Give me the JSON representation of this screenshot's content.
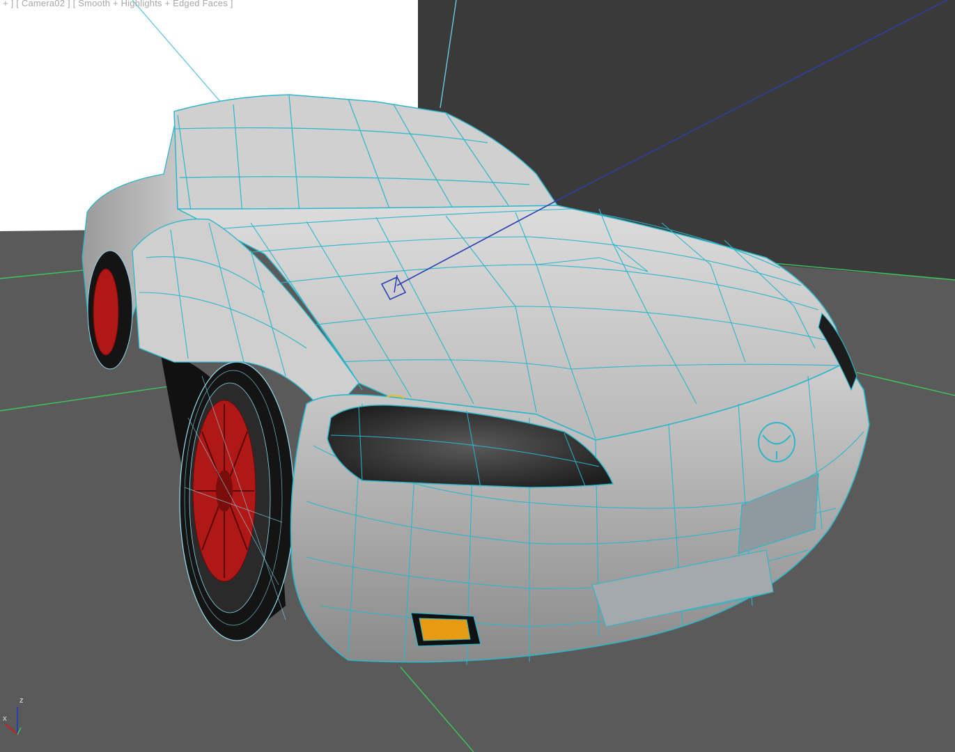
{
  "viewport": {
    "label": "+ ] [ Camera02 ] [ Smooth + Highlights + Edged Faces ]",
    "camera_name": "Camera02",
    "shading_mode": "Smooth + Highlights + Edged Faces"
  },
  "axis_gizmo": {
    "z_label": "z",
    "x_label": "x"
  },
  "scene": {
    "object": "car-mesh",
    "wire_color": "#2bb6c9",
    "body_color": "#c4c4c4",
    "rim_color": "#b01818",
    "grid_color": "#3ec85a",
    "target_line_color": "#2a3fb0",
    "background_color": "#3a3a3a",
    "floor_color": "#5a5a5a",
    "backdrop_color": "#ffffff"
  }
}
